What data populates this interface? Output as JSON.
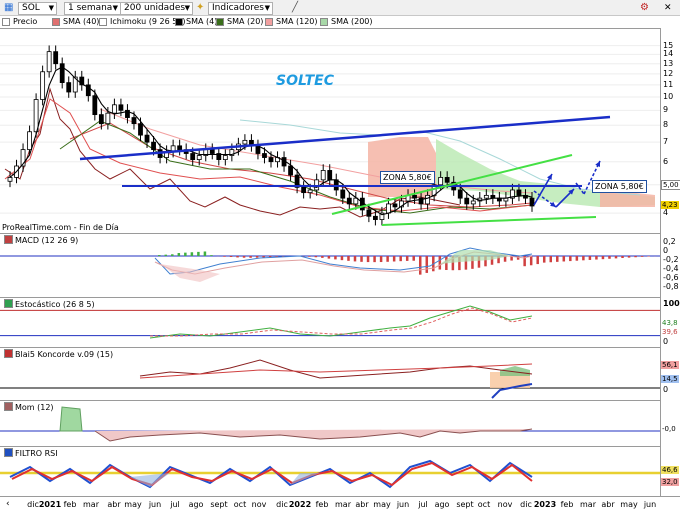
{
  "toolbar": {
    "symbol": "SOL",
    "timeframe": "1 semana",
    "units": "200 unidades",
    "indicators_label": "Indicadores"
  },
  "price_legend": [
    {
      "label": "Precio",
      "color": "#ffffff"
    },
    {
      "label": "SMA (40)",
      "color": "#e07070"
    },
    {
      "label": "Ichimoku (9 26 52)",
      "color": "#ffffff"
    },
    {
      "label": "SMA (4)",
      "color": "#000000"
    },
    {
      "label": "SMA (20)",
      "color": "#3a6e1a"
    },
    {
      "label": "SMA (120)",
      "color": "#f2a0a0"
    },
    {
      "label": "SMA (200)",
      "color": "#a8d8a8"
    }
  ],
  "chart_title": "SOLTEC",
  "zones": [
    "ZONA 5,80€",
    "ZONA 5,80€"
  ],
  "source_text": "ProRealTime.com - Fin de Día",
  "panes": {
    "macd": {
      "label": "MACD (12 26 9)",
      "ticks": [
        "0,2",
        "0",
        "-0,2",
        "-0,4",
        "-0,6",
        "-0,8"
      ]
    },
    "stoch": {
      "label": "Estocástico (26 8 5)",
      "ticks": [
        "100",
        "0"
      ],
      "badges": [
        "43,8",
        "39,6"
      ]
    },
    "koncorde": {
      "label": "Blai5 Koncorde v.09 (15)",
      "ticks": [
        "0"
      ],
      "badges": [
        "56,1",
        "14,5"
      ]
    },
    "mom": {
      "label": "Mom (12)",
      "badges": [
        "-0,0"
      ]
    },
    "rsi": {
      "label": "FILTRO RSI",
      "badges": [
        "46,6",
        "32,0"
      ]
    }
  },
  "price_axis": {
    "ticks": [
      "15",
      "14",
      "13",
      "12",
      "11",
      "10",
      "9",
      "8",
      "7",
      "6",
      "5",
      "4"
    ],
    "badges": [
      "5,00",
      "4,23"
    ]
  },
  "x_axis": [
    "dic",
    "2021",
    "feb",
    "mar",
    "abr",
    "may",
    "jun",
    "jul",
    "ago",
    "sept",
    "oct",
    "nov",
    "dic",
    "2022",
    "feb",
    "mar",
    "abr",
    "may",
    "jun",
    "jul",
    "ago",
    "sept",
    "oct",
    "nov",
    "dic",
    "2023",
    "feb",
    "mar",
    "abr",
    "may",
    "jun"
  ],
  "chart_data": {
    "type": "candlestick",
    "title": "SOLTEC",
    "ylim": [
      3.5,
      15.8
    ],
    "y_scale": "log",
    "x_range": [
      "2020-12",
      "2023-06"
    ],
    "price_weekly_close": [
      5.3,
      5.8,
      6.6,
      7.6,
      9.8,
      12.2,
      14.3,
      13.0,
      11.2,
      10.4,
      11.7,
      11.0,
      10.1,
      8.7,
      8.1,
      8.8,
      9.4,
      9.0,
      8.5,
      8.1,
      7.4,
      7.0,
      6.6,
      6.2,
      6.5,
      6.8,
      6.6,
      6.4,
      6.1,
      6.3,
      6.6,
      6.4,
      6.1,
      6.3,
      6.6,
      6.9,
      7.1,
      6.8,
      6.4,
      6.2,
      6.0,
      6.2,
      5.8,
      5.4,
      4.9,
      4.7,
      4.8,
      5.2,
      5.6,
      5.2,
      4.8,
      4.5,
      4.3,
      4.5,
      4.1,
      3.9,
      3.8,
      4.0,
      4.3,
      4.2,
      4.4,
      4.6,
      4.5,
      4.3,
      4.6,
      5.0,
      5.3,
      5.1,
      4.8,
      4.5,
      4.3,
      4.4,
      4.5,
      4.6,
      4.5,
      4.4,
      4.5,
      4.8,
      4.6,
      4.5,
      4.23
    ],
    "annotations": [
      "ZONA 5,80€",
      "ZONA 5,80€"
    ],
    "last_values": {
      "sma4": 5.0,
      "close": 4.23
    }
  }
}
